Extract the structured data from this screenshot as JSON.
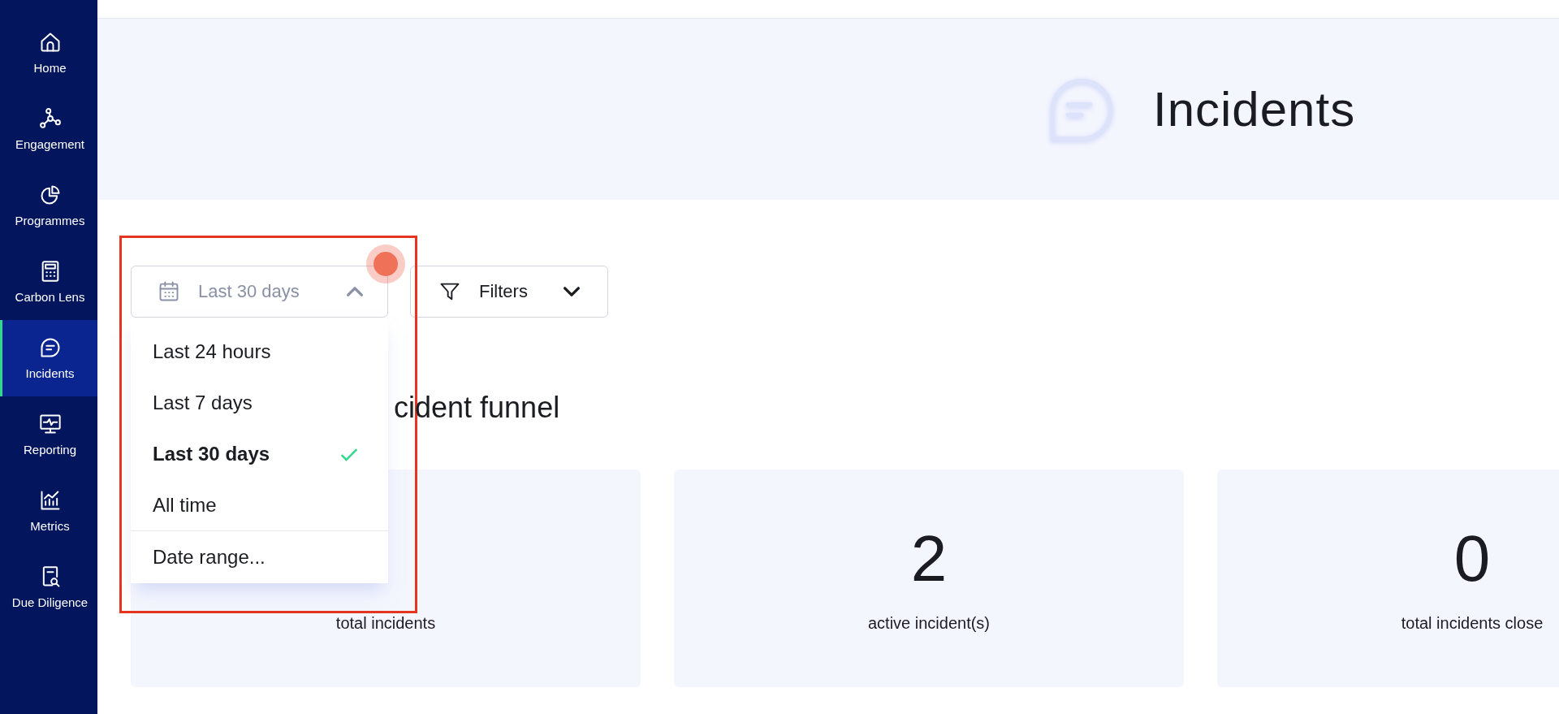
{
  "sidebar": {
    "items": [
      {
        "label": "Home",
        "selected": false
      },
      {
        "label": "Engagement",
        "selected": false
      },
      {
        "label": "Programmes",
        "selected": false
      },
      {
        "label": "Carbon Lens",
        "selected": false
      },
      {
        "label": "Incidents",
        "selected": true
      },
      {
        "label": "Reporting",
        "selected": false
      },
      {
        "label": "Metrics",
        "selected": false
      },
      {
        "label": "Due Diligence",
        "selected": false
      }
    ]
  },
  "header": {
    "title": "Incidents"
  },
  "toolbar": {
    "date_filter": {
      "value": "Last 30 days",
      "expanded": true,
      "options": [
        {
          "label": "Last 24 hours",
          "selected": false
        },
        {
          "label": "Last 7 days",
          "selected": false
        },
        {
          "label": "Last 30 days",
          "selected": true
        },
        {
          "label": "All time",
          "selected": false
        }
      ],
      "custom_option": "Date range..."
    },
    "filters_button": "Filters"
  },
  "section_title": "cident funnel",
  "cards": [
    {
      "label": "total incidents"
    },
    {
      "value": "2",
      "label": "active incident(s)"
    },
    {
      "value": "0",
      "label": "total incidents close"
    }
  ]
}
